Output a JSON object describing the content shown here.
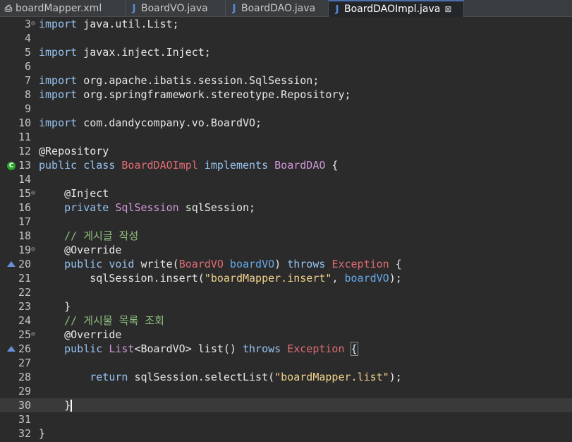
{
  "tabs": [
    {
      "label": "boardMapper.xml",
      "icon": "xml-file-icon"
    },
    {
      "label": "BoardVO.java",
      "icon": "java-file-icon"
    },
    {
      "label": "BoardDAO.java",
      "icon": "java-file-icon"
    },
    {
      "label": "BoardDAOImpl.java",
      "icon": "java-file-icon",
      "active": true
    }
  ],
  "tab_close_glyph": "⊠",
  "java_glyph": "J",
  "xml_glyph": "⎙",
  "lines": [
    {
      "n": "3",
      "fold": "⊖",
      "tokens": [
        [
          "k",
          "import "
        ],
        [
          "tx",
          "java.util.List;"
        ]
      ]
    },
    {
      "n": "4",
      "tokens": []
    },
    {
      "n": "5",
      "tokens": [
        [
          "k",
          "import "
        ],
        [
          "tx",
          "javax.inject.Inject;"
        ]
      ]
    },
    {
      "n": "6",
      "tokens": []
    },
    {
      "n": "7",
      "tokens": [
        [
          "k",
          "import "
        ],
        [
          "tx",
          "org.apache.ibatis.session.SqlSession;"
        ]
      ]
    },
    {
      "n": "8",
      "tokens": [
        [
          "k",
          "import "
        ],
        [
          "tx",
          "org.springframework.stereotype.Repository;"
        ]
      ]
    },
    {
      "n": "9",
      "tokens": []
    },
    {
      "n": "10",
      "tokens": [
        [
          "k",
          "import "
        ],
        [
          "tx",
          "com.dandycompany.vo.BoardVO;"
        ]
      ]
    },
    {
      "n": "11",
      "tokens": []
    },
    {
      "n": "12",
      "tokens": [
        [
          "ann",
          "@Repository"
        ]
      ]
    },
    {
      "n": "13",
      "marker": "class",
      "tokens": [
        [
          "k",
          "public class "
        ],
        [
          "cls",
          "BoardDAOImpl"
        ],
        [
          "k",
          " implements "
        ],
        [
          "iface",
          "BoardDAO"
        ],
        [
          "tx",
          " {"
        ]
      ]
    },
    {
      "n": "14",
      "tokens": []
    },
    {
      "n": "15",
      "fold": "⊖",
      "tokens": [
        [
          "tx",
          "    "
        ],
        [
          "ann",
          "@Inject"
        ]
      ]
    },
    {
      "n": "16",
      "tokens": [
        [
          "tx",
          "    "
        ],
        [
          "k",
          "private "
        ],
        [
          "iface",
          "SqlSession"
        ],
        [
          "tx",
          " sqlSession;"
        ]
      ]
    },
    {
      "n": "17",
      "tokens": []
    },
    {
      "n": "18",
      "tokens": [
        [
          "tx",
          "    "
        ],
        [
          "cm",
          "// 게시글 작성"
        ]
      ]
    },
    {
      "n": "19",
      "fold": "⊖",
      "tokens": [
        [
          "tx",
          "    "
        ],
        [
          "ann",
          "@Override"
        ]
      ]
    },
    {
      "n": "20",
      "marker": "override",
      "tokens": [
        [
          "tx",
          "    "
        ],
        [
          "k",
          "public void "
        ],
        [
          "tx",
          "write("
        ],
        [
          "cls",
          "BoardVO"
        ],
        [
          "fld",
          " boardVO"
        ],
        [
          "tx",
          ") "
        ],
        [
          "k",
          "throws "
        ],
        [
          "cls",
          "Exception"
        ],
        [
          "tx",
          " {"
        ]
      ]
    },
    {
      "n": "21",
      "tokens": [
        [
          "tx",
          "        sqlSession.insert("
        ],
        [
          "str",
          "\"boardMapper.insert\""
        ],
        [
          "tx",
          ", "
        ],
        [
          "fld",
          "boardVO"
        ],
        [
          "tx",
          ");"
        ]
      ]
    },
    {
      "n": "22",
      "tokens": []
    },
    {
      "n": "23",
      "tokens": [
        [
          "tx",
          "    }"
        ]
      ]
    },
    {
      "n": "24",
      "tokens": [
        [
          "tx",
          "    "
        ],
        [
          "cm",
          "// 게시물 목록 조회"
        ]
      ]
    },
    {
      "n": "25",
      "fold": "⊖",
      "tokens": [
        [
          "tx",
          "    "
        ],
        [
          "ann",
          "@Override"
        ]
      ]
    },
    {
      "n": "26",
      "marker": "override",
      "tokens": [
        [
          "tx",
          "    "
        ],
        [
          "k",
          "public "
        ],
        [
          "iface",
          "List"
        ],
        [
          "tx",
          "<BoardVO> list() "
        ],
        [
          "k",
          "throws "
        ],
        [
          "cls",
          "Exception"
        ],
        [
          "tx",
          " "
        ],
        [
          "bracket",
          "{"
        ]
      ]
    },
    {
      "n": "27",
      "tokens": []
    },
    {
      "n": "28",
      "tokens": [
        [
          "tx",
          "        "
        ],
        [
          "k",
          "return "
        ],
        [
          "tx",
          "sqlSession.selectList("
        ],
        [
          "str",
          "\"boardMapper.list\""
        ],
        [
          "tx",
          ");"
        ]
      ]
    },
    {
      "n": "29",
      "tokens": []
    },
    {
      "n": "30",
      "current": true,
      "tokens": [
        [
          "tx",
          "    }"
        ],
        [
          "cursor",
          ""
        ]
      ]
    },
    {
      "n": "31",
      "tokens": []
    },
    {
      "n": "32",
      "tokens": [
        [
          "tx",
          "}"
        ]
      ]
    }
  ]
}
